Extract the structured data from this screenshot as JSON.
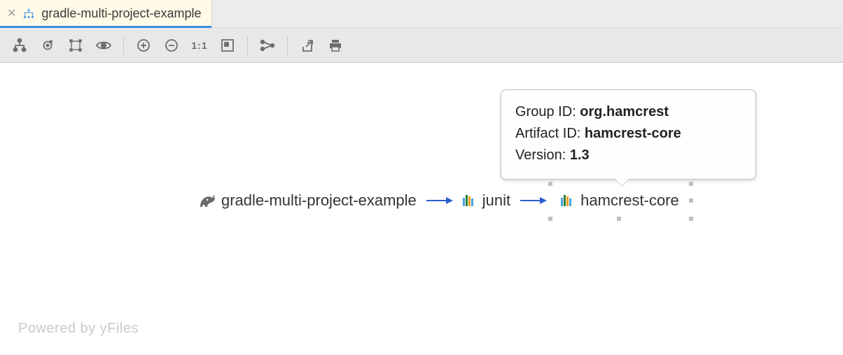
{
  "tab": {
    "title": "gradle-multi-project-example"
  },
  "toolbar": {
    "icons": {
      "layout": "layout-icon",
      "findPath": "find-path-icon",
      "selection": "selection-icon",
      "showHide": "eye-icon",
      "zoomIn": "zoom-in-icon",
      "zoomOut": "zoom-out-icon",
      "actualSize": "one-to-one-icon",
      "fitContent": "fit-content-icon",
      "showPaths": "show-paths-icon",
      "openNew": "open-new-window-icon",
      "print": "print-icon"
    },
    "oneToOneLabel": "1:1"
  },
  "graph": {
    "root": {
      "label": "gradle-multi-project-example",
      "icon": "gradle-icon"
    },
    "dep1": {
      "label": "junit",
      "icon": "library-icon"
    },
    "dep2": {
      "label": "hamcrest-core",
      "icon": "library-icon"
    }
  },
  "tooltip": {
    "groupLabel": "Group ID: ",
    "groupValue": "org.hamcrest",
    "artifactLabel": "Artifact ID: ",
    "artifactValue": "hamcrest-core",
    "versionLabel": "Version: ",
    "versionValue": "1.3"
  },
  "footer": {
    "text": "Powered by yFiles"
  }
}
